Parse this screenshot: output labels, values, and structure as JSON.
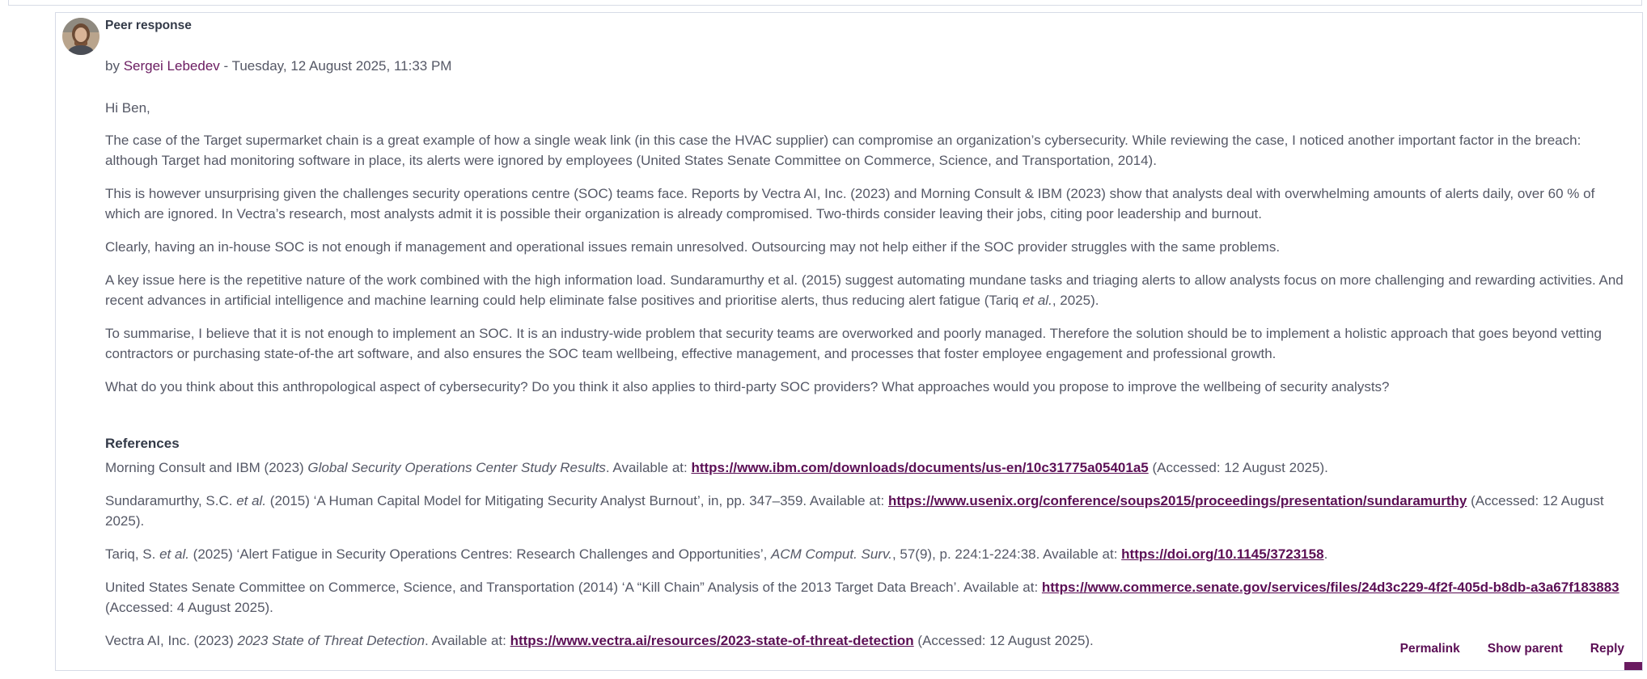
{
  "post": {
    "subject": "Peer response",
    "by_prefix": "by ",
    "author": "Sergei Lebedev",
    "date_sep": " - ",
    "date": "Tuesday, 12 August 2025, 11:33 PM",
    "avatar_icon": "user-avatar-photo",
    "greeting": "Hi Ben,",
    "paragraphs": [
      "The case of the Target supermarket chain is a great example of how a single weak link (in this case the HVAC supplier) can compromise an organization’s cybersecurity. While reviewing the case, I noticed another important factor in the breach: although Target had monitoring software in place, its alerts were ignored by employees (United States Senate Committee on Commerce, Science, and Transportation, 2014).",
      "This is however unsurprising given the challenges security operations centre (SOC) teams face. Reports by Vectra AI, Inc. (2023) and Morning Consult & IBM (2023) show that analysts deal with overwhelming amounts of alerts daily, over 60 % of which are ignored. In Vectra’s research, most analysts admit it is possible their organization is already compromised. Two-thirds consider leaving their jobs, citing poor leadership and burnout.",
      "Clearly, having an in-house SOC is not enough if management and operational issues remain unresolved. Outsourcing may not help either if the SOC provider struggles with the same problems."
    ],
    "p4_a": "A key issue here is the repetitive nature of the work combined with the high information load. Sundaramurthy et al. (2015) suggest automating mundane tasks and triaging alerts to allow analysts focus on more challenging and rewarding activities. And recent advances in artificial intelligence and machine learning could help eliminate false positives and prioritise alerts, thus reducing alert fatigue (Tariq ",
    "p4_em": "et al.",
    "p4_b": ", 2025).",
    "p5": "To summarise, I believe that it is not enough to implement an SOC. It is an industry-wide problem that security teams are overworked and poorly managed. Therefore the solution should be to implement a holistic approach that goes beyond vetting contractors or purchasing state-of-the art software, and also ensures the SOC team wellbeing, effective management, and processes that foster employee engagement and professional growth.",
    "p6": "What do you think about this anthropological aspect of cybersecurity? Do you think it also applies to third-party SOC providers? What approaches would you propose to improve the wellbeing of security analysts?"
  },
  "references": {
    "heading": "References",
    "r1": {
      "a": "Morning Consult and IBM (2023) ",
      "em": "Global Security Operations Center Study Results",
      "b": ". Available at: ",
      "link": "https://www.ibm.com/downloads/documents/us-en/10c31775a05401a5",
      "c": " (Accessed: 12 August 2025)."
    },
    "r2": {
      "a": "Sundaramurthy, S.C. ",
      "em": "et al.",
      "b": " (2015) ‘A Human Capital Model for Mitigating Security Analyst Burnout’, in, pp. 347–359. Available at: ",
      "link": "https://www.usenix.org/conference/soups2015/proceedings/presentation/sundaramurthy",
      "c": " (Accessed: 12 August 2025)."
    },
    "r3": {
      "a": "Tariq, S. ",
      "em": "et al.",
      "b": " (2025) ‘Alert Fatigue in Security Operations Centres: Research Challenges and Opportunities’, ",
      "em2": "ACM Comput. Surv.",
      "c": ", 57(9), p. 224:1-224:38. Available at: ",
      "link": "https://doi.org/10.1145/3723158",
      "d": "."
    },
    "r4": {
      "a": "United States Senate Committee on Commerce, Science, and Transportation (2014) ‘A “Kill Chain” Analysis of the 2013 Target Data Breach’. Available at: ",
      "link": "https://www.commerce.senate.gov/services/files/24d3c229-4f2f-405d-b8db-a3a67f183883",
      "c": " (Accessed: 4 August 2025)."
    },
    "r5": {
      "a": "Vectra AI, Inc. (2023) ",
      "em": "2023 State of Threat Detection",
      "b": ". Available at: ",
      "link": "https://www.vectra.ai/resources/2023-state-of-threat-detection",
      "c": " (Accessed: 12 August 2025)."
    }
  },
  "actions": {
    "permalink": "Permalink",
    "show_parent": "Show parent",
    "reply": "Reply"
  },
  "colors": {
    "accent": "#6a1b60",
    "link": "#5b0f55",
    "text": "#555866",
    "border": "#d7dbe6"
  }
}
